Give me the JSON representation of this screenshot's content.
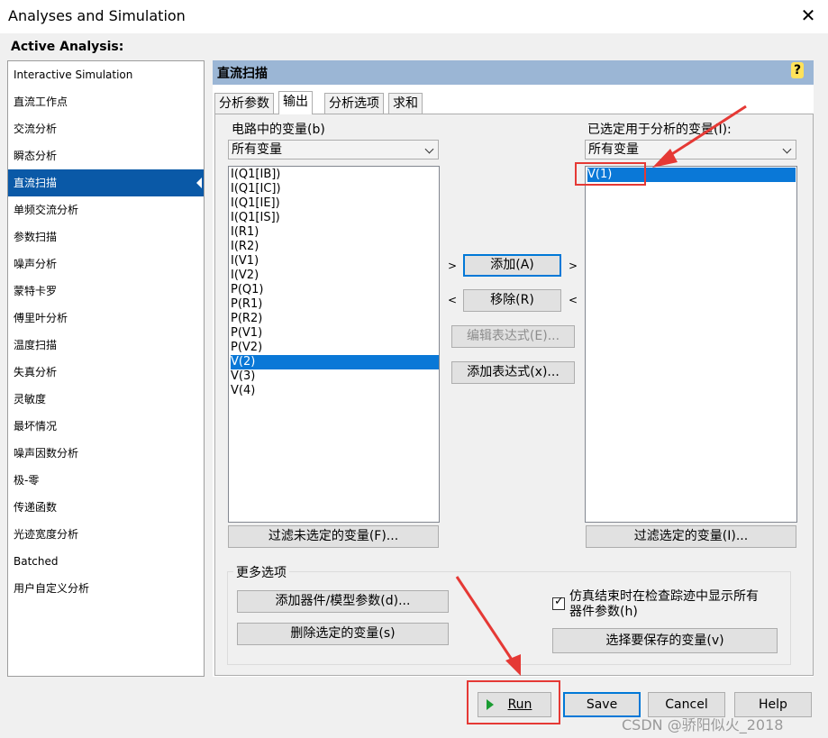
{
  "window": {
    "title": "Analyses and Simulation",
    "close_glyph": "✕"
  },
  "active_analysis_label": "Active Analysis:",
  "sidebar": {
    "items": [
      "Interactive Simulation",
      "直流工作点",
      "交流分析",
      "瞬态分析",
      "直流扫描",
      "单频交流分析",
      "参数扫描",
      "噪声分析",
      "蒙特卡罗",
      "傅里叶分析",
      "温度扫描",
      "失真分析",
      "灵敏度",
      "最坏情况",
      "噪声因数分析",
      "极-零",
      "传递函数",
      "光迹宽度分析",
      "Batched",
      "用户自定义分析"
    ],
    "selected": "直流扫描"
  },
  "panel": {
    "title": "直流扫描",
    "help_glyph": "?"
  },
  "tabs": [
    "分析参数",
    "输出",
    "分析选项",
    "求和"
  ],
  "active_tab": "输出",
  "left": {
    "label": "电路中的变量(b)",
    "filter": "所有变量",
    "items": [
      "I(Q1[IB])",
      "I(Q1[IC])",
      "I(Q1[IE])",
      "I(Q1[IS])",
      "I(R1)",
      "I(R2)",
      "I(V1)",
      "I(V2)",
      "P(Q1)",
      "P(R1)",
      "P(R2)",
      "P(V1)",
      "P(V2)",
      "V(2)",
      "V(3)",
      "V(4)"
    ],
    "selected": "V(2)",
    "filter_button": "过滤未选定的变量(F)..."
  },
  "right": {
    "label": "已选定用于分析的变量(I):",
    "filter": "所有变量",
    "items": [
      "V(1)"
    ],
    "selected": "V(1)",
    "filter_button": "过滤选定的变量(I)..."
  },
  "middle": {
    "add": "添加(A)",
    "remove": "移除(R)",
    "edit_expr": "编辑表达式(E)...",
    "add_expr": "添加表达式(x)...",
    "arrow_right": ">",
    "arrow_left": "<"
  },
  "more": {
    "title": "更多选项",
    "add_param": "添加器件/模型参数(d)...",
    "delete_selected": "删除选定的变量(s)",
    "show_all_line1": "仿真结束时在检查踪迹中显示所有",
    "show_all_line2": "器件参数(h)",
    "show_all_checked": true,
    "choose_save": "选择要保存的变量(v)"
  },
  "footer": {
    "run": "Run",
    "save": "Save",
    "cancel": "Cancel",
    "help": "Help"
  },
  "watermark": "CSDN @骄阳似火_2018",
  "colors": {
    "selection": "#0a59a7",
    "header": "#9bb6d5",
    "annotation": "#e53935"
  }
}
